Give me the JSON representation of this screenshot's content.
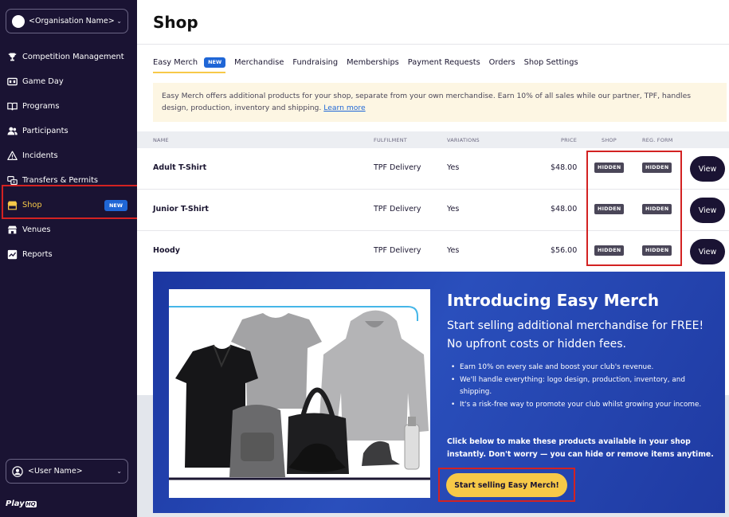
{
  "sidebar": {
    "org_name": "<Organisation Name>",
    "items": [
      {
        "label": "Competition Management",
        "icon": "trophy-icon"
      },
      {
        "label": "Game Day",
        "icon": "scoreboard-icon"
      },
      {
        "label": "Programs",
        "icon": "book-icon"
      },
      {
        "label": "Participants",
        "icon": "people-icon"
      },
      {
        "label": "Incidents",
        "icon": "warning-icon"
      },
      {
        "label": "Transfers & Permits",
        "icon": "transfer-icon"
      },
      {
        "label": "Shop",
        "icon": "shop-icon",
        "badge": "NEW",
        "active": true
      },
      {
        "label": "Venues",
        "icon": "venue-icon"
      },
      {
        "label": "Reports",
        "icon": "chart-icon"
      }
    ],
    "user_name": "<User Name>",
    "logo_text": "Play",
    "logo_badge": "HQ"
  },
  "page": {
    "title": "Shop",
    "tabs": [
      {
        "label": "Easy Merch",
        "badge": "NEW",
        "active": true
      },
      {
        "label": "Merchandise"
      },
      {
        "label": "Fundraising"
      },
      {
        "label": "Memberships"
      },
      {
        "label": "Payment Requests"
      },
      {
        "label": "Orders"
      },
      {
        "label": "Shop Settings"
      }
    ],
    "info_text": "Easy Merch offers additional products for your shop, separate from your own merchandise. Earn 10% of all sales while our partner, TPF, handles design, production, inventory and shipping.",
    "info_link": "Learn more"
  },
  "table": {
    "headers": {
      "name": "NAME",
      "fulfilment": "FULFILMENT",
      "variations": "VARIATIONS",
      "price": "PRICE",
      "shop": "SHOP",
      "reg_form": "REG. FORM"
    },
    "rows": [
      {
        "name": "Adult T-Shirt",
        "fulfilment": "TPF Delivery",
        "variations": "Yes",
        "price": "$48.00",
        "shop": "HIDDEN",
        "reg_form": "HIDDEN",
        "action": "View"
      },
      {
        "name": "Junior T-Shirt",
        "fulfilment": "TPF Delivery",
        "variations": "Yes",
        "price": "$48.00",
        "shop": "HIDDEN",
        "reg_form": "HIDDEN",
        "action": "View"
      },
      {
        "name": "Hoody",
        "fulfilment": "TPF Delivery",
        "variations": "Yes",
        "price": "$56.00",
        "shop": "HIDDEN",
        "reg_form": "HIDDEN",
        "action": "View"
      }
    ]
  },
  "banner": {
    "title": "Introducing Easy Merch",
    "subtitle_1": "Start selling additional merchandise for FREE!",
    "subtitle_2": "No upfront costs or hidden fees.",
    "bullets": [
      "Earn 10% on every sale and boost your club's revenue.",
      "We'll handle everything: logo design, production, inventory, and shipping.",
      "It's a risk-free way to promote your club whilst growing your income."
    ],
    "cta_text": "Click below to make these products available in your shop instantly. Don't worry — you can hide or remove items anytime.",
    "cta_button": "Start selling Easy Merch!"
  },
  "colors": {
    "sidebar_bg": "#1a1333",
    "accent_yellow": "#f7c948",
    "badge_blue": "#1f66d6",
    "banner_blue": "#2344a8",
    "highlight_red": "#d32222"
  }
}
